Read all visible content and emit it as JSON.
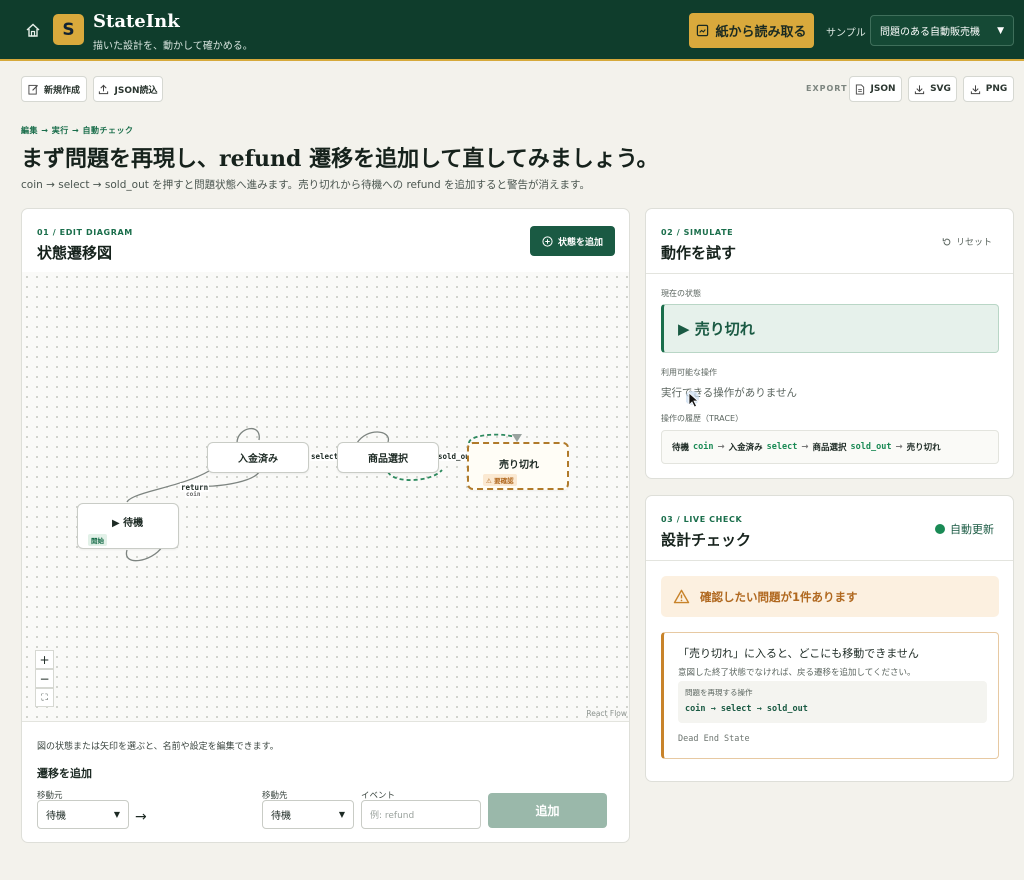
{
  "header": {
    "logo_letter": "S",
    "app_name": "StateInk",
    "tagline": "描いた設計を、動かして確かめる。",
    "scan_button": "紙から読み取る",
    "sample_label": "サンプル",
    "sample_selected": "問題のある自動販売機"
  },
  "toolbar": {
    "new_label": "新規作成",
    "load_json_label": "JSON読込",
    "export_label": "EXPORT",
    "export_json": "JSON",
    "export_svg": "SVG",
    "export_png": "PNG"
  },
  "tutorial": {
    "breadcrumb": "編集 → 実行 → 自動チェック",
    "headline": "まず問題を再現し、refund 遷移を追加して直してみましょう。",
    "description": "coin → select → sold_out を押すと問題状態へ進みます。売り切れから待機への refund を追加すると警告が消えます。"
  },
  "diagram": {
    "tag": "01 / EDIT DIAGRAM",
    "title": "状態遷移図",
    "add_state_button": "状態を追加",
    "nodes": [
      {
        "label": "入金済み"
      },
      {
        "label": "商品選択"
      },
      {
        "label": "売り切れ",
        "badge": "⚠ 要確認"
      },
      {
        "label": "▶ 待機",
        "badge": "開始"
      }
    ],
    "edge_labels": [
      "select",
      "sold_out",
      "return",
      "coin"
    ],
    "zoom_in": "+",
    "zoom_out": "−",
    "fit": "⛶",
    "attribution": "React Flow",
    "hint": "図の状態または矢印を選ぶと、名前や設定を編集できます。",
    "add_transition_title": "遷移を追加",
    "from_label": "移動元",
    "from_value": "待機",
    "arrow": "→",
    "to_label": "移動先",
    "to_value": "待機",
    "event_label": "イベント",
    "event_placeholder": "例: refund",
    "add_button": "追加"
  },
  "simulate": {
    "tag": "02 / SIMULATE",
    "title": "動作を試す",
    "reset": "リセット",
    "current_state_label": "現在の状態",
    "current_state": "▶ 売り切れ",
    "available_label": "利用可能な操作",
    "no_actions": "実行できる操作がありません",
    "trace_label": "操作の履歴（TRACE）",
    "trace": {
      "s1": "待機",
      "e1": "coin",
      "s2": "入金済み",
      "e2": "select",
      "s3": "商品選択",
      "e3": "sold_out",
      "s4": "売り切れ",
      "arrow": "→"
    }
  },
  "check": {
    "tag": "03 / LIVE CHECK",
    "title": "設計チェック",
    "auto_update": "自動更新",
    "alert": "確認したい問題が1件あります",
    "issue_title": "「売り切れ」に入ると、どこにも移動できません",
    "issue_desc": "意図した終了状態でなければ、戻る遷移を追加してください。",
    "repro_label": "問題を再現する操作",
    "repro_steps": "coin → select → sold_out",
    "code": "Dead End State"
  },
  "colors": {
    "header_bg": "#0f3d2c",
    "accent": "#d9a93c",
    "primary": "#1a5a43",
    "warning": "#c8832a"
  }
}
